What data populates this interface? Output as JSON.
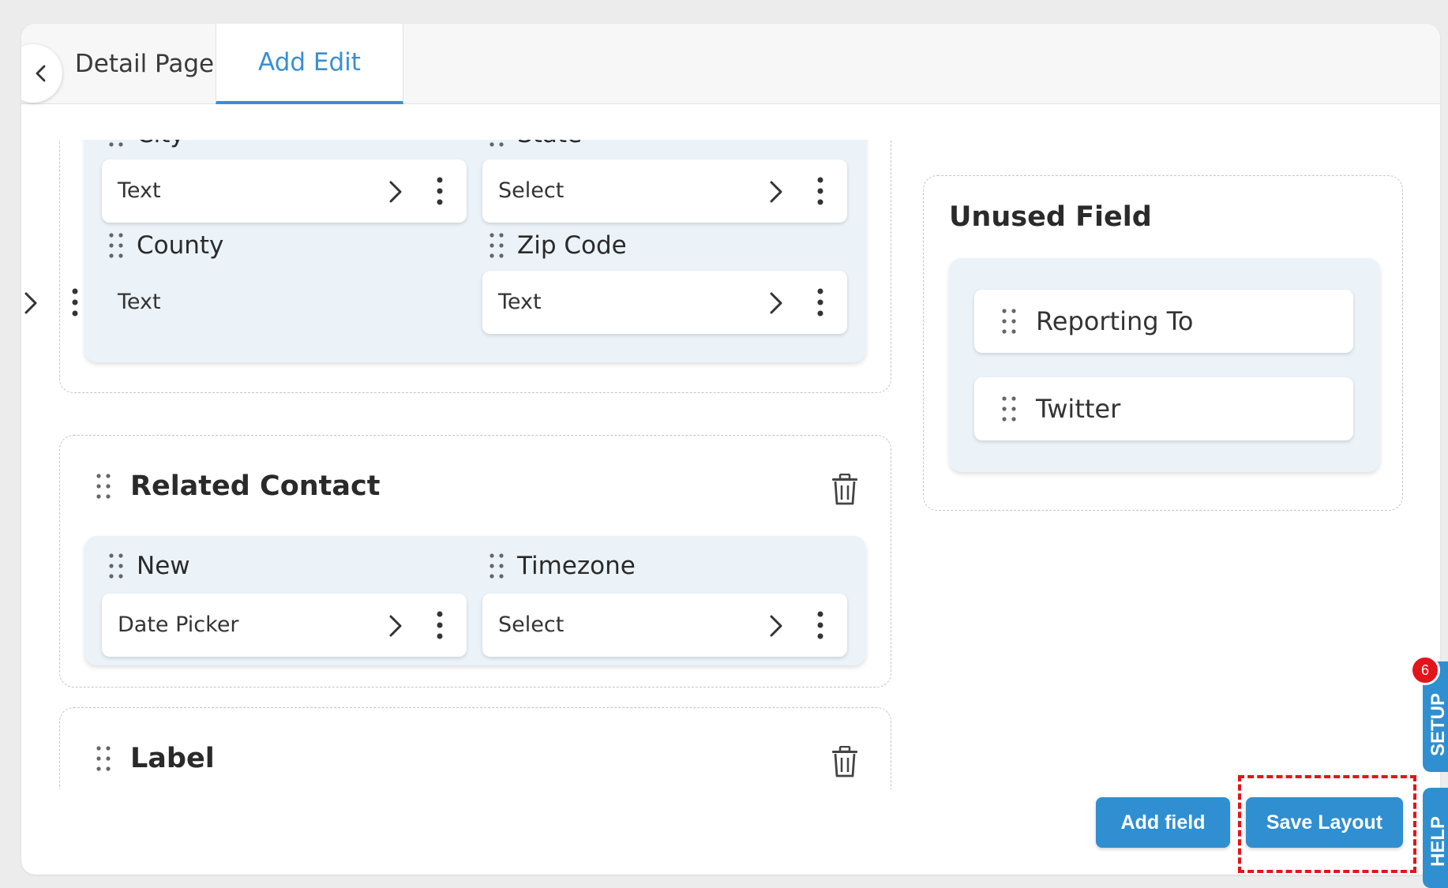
{
  "tabs": {
    "detail_page": "Detail Page",
    "add_edit": "Add Edit"
  },
  "address_section": {
    "fields": [
      {
        "label": "City",
        "type": "Text"
      },
      {
        "label": "State",
        "type": "Select"
      },
      {
        "label": "County",
        "type": "Text"
      },
      {
        "label": "Zip Code",
        "type": "Text"
      }
    ]
  },
  "related_contact": {
    "title": "Related Contact",
    "fields": [
      {
        "label": "New",
        "type": "Date Picker"
      },
      {
        "label": "Timezone",
        "type": "Select"
      }
    ]
  },
  "label_section": {
    "title": "Label"
  },
  "unused": {
    "title": "Unused Field",
    "items": [
      "Reporting To",
      "Twitter"
    ]
  },
  "buttons": {
    "add_field": "Add field",
    "save_layout": "Save Layout"
  },
  "side_tabs": {
    "setup": "SETUP",
    "help": "HELP",
    "badge": "6"
  },
  "colors": {
    "accent": "#2f8fd0",
    "highlight": "#e3141b",
    "panel": "#ebf3f9"
  }
}
